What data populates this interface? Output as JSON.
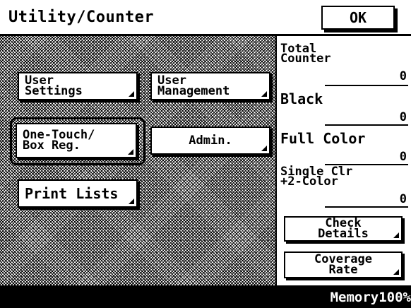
{
  "header": {
    "title": "Utility/Counter",
    "ok_label": "OK"
  },
  "buttons": {
    "user_settings": "User\nSettings",
    "user_management": "User\nManagement",
    "one_touch": "One-Touch/\nBox Reg.",
    "admin": "Admin.",
    "print_lists": "Print Lists"
  },
  "counters": [
    {
      "label": "Total\nCounter",
      "value": "0"
    },
    {
      "label": "Black",
      "value": "0"
    },
    {
      "label": "Full Color",
      "value": "0"
    },
    {
      "label": "Single Clr\n+2-Color",
      "value": "0"
    }
  ],
  "side_buttons": {
    "check_details": "Check\nDetails",
    "coverage_rate": "Coverage\nRate"
  },
  "status": {
    "memory": "Memory100%"
  }
}
